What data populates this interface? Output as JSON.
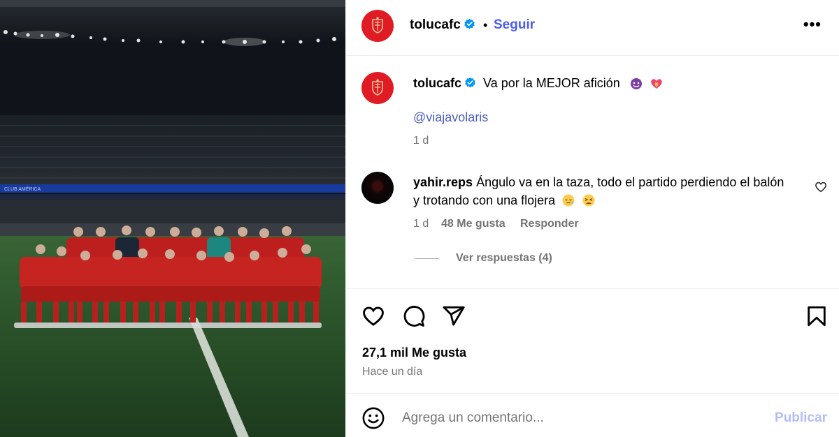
{
  "colors": {
    "accent": "#4a5cf0",
    "brand_red": "#e01b24",
    "muted": "#737373",
    "publish_disabled": "#b2bdf7"
  },
  "photo": {
    "banner_text": "CLUB AMÉRICA"
  },
  "header": {
    "username": "tolucafc",
    "separator": "•",
    "follow_label": "Seguir",
    "more_icon": "more-icon"
  },
  "caption": {
    "username": "tolucafc",
    "text": "Va por la MEJOR afición",
    "emojis": [
      "smiling-devil-emoji",
      "heart-on-fire-emoji"
    ],
    "mention": "@viajavolaris",
    "time": "1 d"
  },
  "comment": {
    "username": "yahir.reps",
    "text": "Ángulo va en la taza, todo el partido perdiendo el balón y trotando con una flojera",
    "emojis": [
      "sleepy-face-emoji",
      "tired-face-emoji"
    ],
    "time": "1 d",
    "likes": "48 Me gusta",
    "reply_label": "Responder",
    "view_replies": "Ver respuestas (4)"
  },
  "actions": {
    "icons": [
      "heart-icon",
      "comment-icon",
      "share-icon",
      "bookmark-icon"
    ]
  },
  "stats": {
    "likes": "27,1 mil Me gusta",
    "time": "Hace un día"
  },
  "add_comment": {
    "placeholder": "Agrega un comentario...",
    "publish_label": "Publicar"
  }
}
